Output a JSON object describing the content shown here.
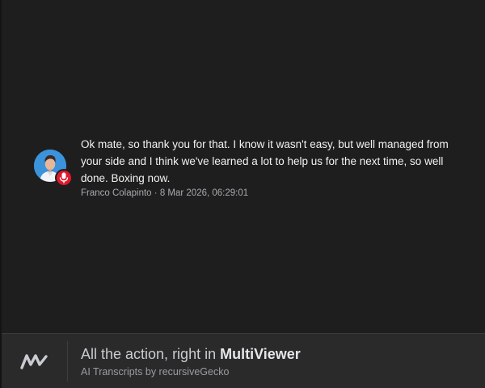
{
  "message": {
    "text": "Ok mate, so thank you for that. I know it wasn't easy, but well managed from your side and I think we've learned a lot to help us for the next time, so well done. Boxing now.",
    "author": "Franco Colapinto",
    "separator": "·",
    "timestamp": "8 Mar 2026, 06:29:01",
    "avatar_icon": "driver-avatar",
    "badge_icon": "microphone-icon",
    "badge_color": "#e0192b"
  },
  "footer": {
    "logo_icon": "multiviewer-logo",
    "tagline_prefix": "All the action, right in ",
    "tagline_brand": "MultiViewer",
    "subtitle": "AI Transcripts by recursiveGecko"
  }
}
